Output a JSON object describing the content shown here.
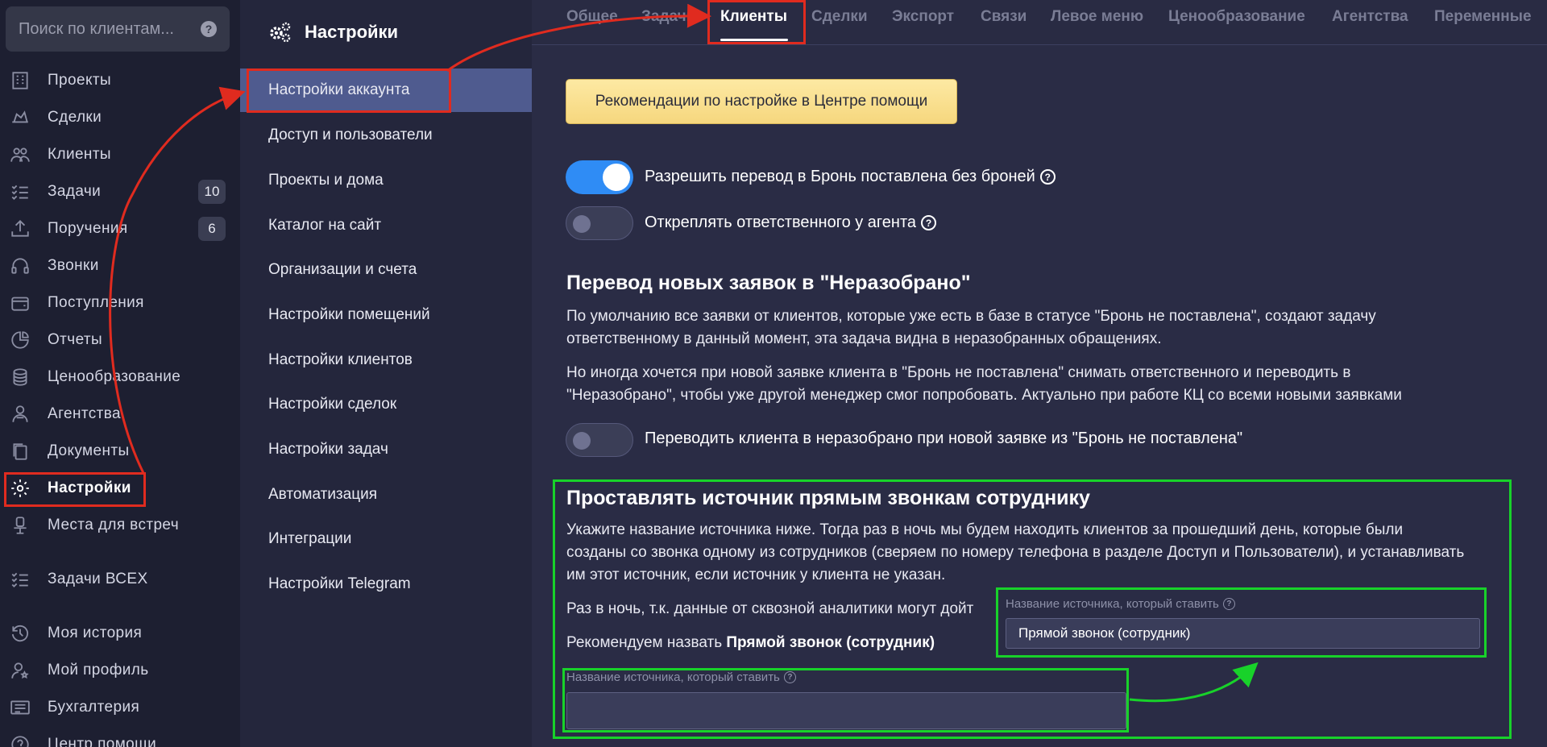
{
  "search": {
    "placeholder": "Поиск по клиентам...",
    "help_icon": "?"
  },
  "sidebar": {
    "items": [
      {
        "label": "Проекты",
        "icon": "building-icon"
      },
      {
        "label": "Сделки",
        "icon": "deal-icon"
      },
      {
        "label": "Клиенты",
        "icon": "users-icon"
      },
      {
        "label": "Задачи",
        "icon": "tasks-icon",
        "badge": "10"
      },
      {
        "label": "Поручения",
        "icon": "upload-icon",
        "badge": "6"
      },
      {
        "label": "Звонки",
        "icon": "headset-icon"
      },
      {
        "label": "Поступления",
        "icon": "wallet-icon"
      },
      {
        "label": "Отчеты",
        "icon": "pie-icon"
      },
      {
        "label": "Ценообразование",
        "icon": "coins-icon"
      },
      {
        "label": "Агентства",
        "icon": "agent-icon"
      },
      {
        "label": "Документы",
        "icon": "documents-icon"
      },
      {
        "label": "Настройки",
        "icon": "gear-icon"
      },
      {
        "label": "Места для встреч",
        "icon": "meeting-icon"
      },
      {
        "label": "Задачи ВСЕХ",
        "icon": "tasks-all-icon"
      },
      {
        "label": "Моя история",
        "icon": "history-icon"
      },
      {
        "label": "Мой профиль",
        "icon": "profile-icon"
      },
      {
        "label": "Бухгалтерия",
        "icon": "accounting-icon"
      },
      {
        "label": "Центр помощи",
        "icon": "help-icon"
      }
    ]
  },
  "settings_nav": {
    "title": "Настройки",
    "items": [
      "Настройки аккаунта",
      "Доступ и пользователи",
      "Проекты и дома",
      "Каталог на сайт",
      "Организации и счета",
      "Настройки помещений",
      "Настройки клиентов",
      "Настройки сделок",
      "Настройки задач",
      "Автоматизация",
      "Интеграции",
      "Настройки Telegram"
    ]
  },
  "tabs": [
    "Общее",
    "Задачи",
    "Клиенты",
    "Сделки",
    "Экспорт",
    "Связи",
    "Левое меню",
    "Ценообразование",
    "Агентства",
    "Переменные"
  ],
  "content": {
    "help_banner": "Рекомендации по настройке в Центре помощи",
    "toggle1": {
      "label": "Разрешить перевод в Бронь поставлена без броней",
      "state": "on"
    },
    "toggle2": {
      "label": "Открeплять ответственного у агента",
      "state": "off"
    },
    "section1": {
      "title": "Перевод новых заявок в \"Неразобрано\"",
      "p1a": "По умолчанию все заявки от клиентов, которые уже есть в базе в статусе \"Бронь не поставлена\", создают задачу",
      "p1b": "ответственному в данный момент, эта задача видна в неразобранных обращениях.",
      "p2a": "Но иногда хочется при новой заявке клиента в \"Бронь не поставлена\" снимать ответственного и переводить в",
      "p2b": "\"Неразобрано\", чтобы уже другой менеджер смог попробовать. Актуально при работе КЦ со всеми новыми заявками",
      "toggle": {
        "label": "Переводить клиента в неразобрано при новой заявке из \"Бронь не поставлена\"",
        "state": "off"
      }
    },
    "section2": {
      "title": "Проставлять источник прямым звонкам сотруднику",
      "p1a": "Укажите название источника ниже. Тогда раз в ночь мы будем находить клиентов за прошедший день, которые были",
      "p1b": "созданы со звонка одному из сотрудников (сверяем по номеру телефона в разделе Доступ и Пользователи), и устанавливать",
      "p1c": "им этот источник, если источник у клиента не указан.",
      "p2": "Раз в ночь, т.к. данные от сквозной аналитики могут дойт",
      "p3_prefix": "Рекомендуем назвать ",
      "p3_bold": "Прямой звонок (сотрудник)",
      "field_label": "Название источника, который ставить",
      "field_value": "",
      "popup_label": "Название источника, который ставить",
      "popup_value": "Прямой звонок (сотрудник)"
    }
  },
  "colors": {
    "highlight_red": "#e02b1f",
    "highlight_green": "#18d22a",
    "toggle_on": "#2f8cf5",
    "banner": "#fde9a3"
  }
}
